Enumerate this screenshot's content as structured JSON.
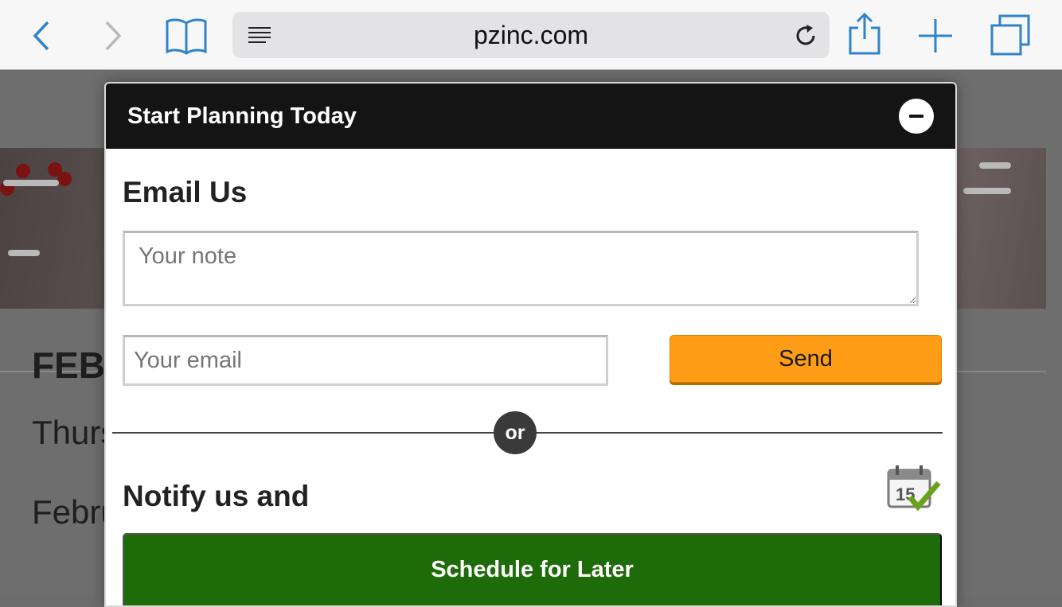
{
  "browser": {
    "url": "pzinc.com",
    "accent_color": "#2f83c9",
    "icons": [
      "back-icon",
      "forward-icon",
      "bookmarks-icon",
      "reader-icon",
      "reload-icon",
      "share-icon",
      "new-tab-icon",
      "tabs-icon"
    ]
  },
  "background_page": {
    "heading": "FEB",
    "line1": "Thurs",
    "line2": "Febru"
  },
  "modal": {
    "title": "Start Planning Today",
    "email_section_title": "Email Us",
    "note_placeholder": "Your note",
    "email_placeholder": "Your email",
    "send_label": "Send",
    "or_label": "or",
    "notify_title": "Notify us and",
    "calendar_day": "15",
    "schedule_label": "Schedule for Later",
    "colors": {
      "header_bg": "#141414",
      "send_bg": "#ff9e16",
      "schedule_bg": "#1e6b09"
    }
  }
}
